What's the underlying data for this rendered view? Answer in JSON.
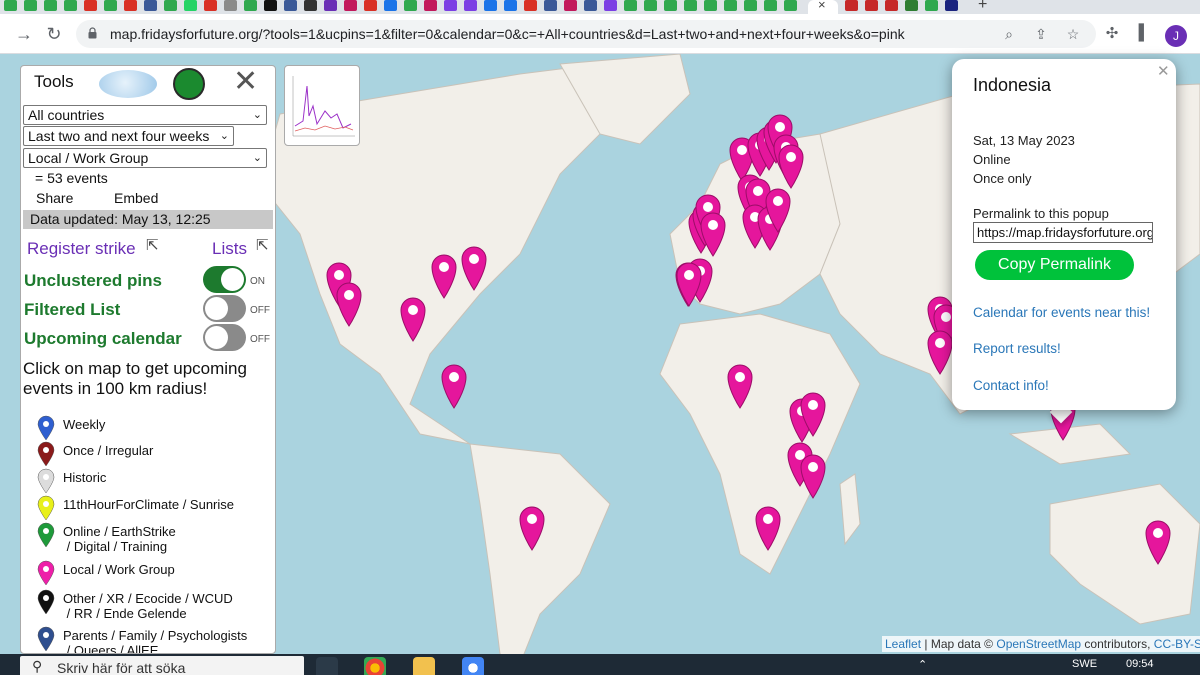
{
  "browser": {
    "url": "map.fridaysforfuture.org/?tools=1&ucpins=1&filter=0&calendar=0&c=+All+countries&d=Last+two+and+next+four+weeks&o=pink",
    "profile_initial": "J",
    "tab_favicon_colors": [
      "#2fa84f",
      "#2fa84f",
      "#2fa84f",
      "#2fa84f",
      "#d93025",
      "#2fa84f",
      "#d93025",
      "#3b5998",
      "#2fa84f",
      "#25d366",
      "#d93025",
      "#8a8a8a",
      "#2fa84f",
      "#111111",
      "#3b5998",
      "#333333",
      "#6a2fb5",
      "#c2185b",
      "#d93025",
      "#1a73e8",
      "#2fa84f",
      "#c2185b",
      "#7b3fe4",
      "#7b3fe4",
      "#1a73e8",
      "#1a73e8",
      "#d93025",
      "#3b5998",
      "#c2185b",
      "#3b5998",
      "#7b3fe4",
      "#2fa84f",
      "#2fa84f",
      "#2fa84f",
      "#2fa84f",
      "#2fa84f",
      "#2fa84f",
      "#2fa84f",
      "#2fa84f",
      "#2fa84f"
    ],
    "right_tab_favicon_colors": [
      "#c62828",
      "#c62828",
      "#c62828",
      "#2e7d32",
      "#2fa84f",
      "#1a237e"
    ]
  },
  "tools": {
    "title": "Tools",
    "country_select": "All countries",
    "period_select": "Last two and next four weeks",
    "type_select": "Local / Work Group",
    "event_count": "= 53 events",
    "share": "Share",
    "embed": "Embed",
    "data_updated": "Data updated: May 13, 12:25",
    "register_strike": "Register strike",
    "lists": "Lists",
    "toggles": [
      {
        "label": "Unclustered pins",
        "state": "ON",
        "on": true
      },
      {
        "label": "Filtered List",
        "state": "OFF",
        "on": false
      },
      {
        "label": "Upcoming calendar",
        "state": "OFF",
        "on": false
      }
    ],
    "hint": "Click on map to get upcoming events in 100 km radius!",
    "legend": [
      {
        "label": "Weekly",
        "color": "#2f5fd0"
      },
      {
        "label": "Once / Irregular",
        "color": "#8b1a1a"
      },
      {
        "label": "Historic",
        "color": "#dcdcdc"
      },
      {
        "label": "11thHourForClimate / Sunrise",
        "color": "#e8f01a"
      },
      {
        "label": "Online / EarthStrike\n / Digital / Training",
        "color": "#1e9a3a"
      },
      {
        "label": "Local / Work Group",
        "color": "#ee1fa9"
      },
      {
        "label": "Other / XR / Ecocide / WCUD\n / RR / Ende Gelende",
        "color": "#111111"
      },
      {
        "label": "Parents / Family / Psychologists\n / Queers / AllEE",
        "color": "#2f4f8f"
      }
    ]
  },
  "popup": {
    "title": "Indonesia",
    "date": "Sat, 13 May 2023",
    "mode": "Online",
    "frequency": "Once only",
    "permalink_label": "Permalink to this popup",
    "permalink_value": "https://map.fridaysforfuture.org",
    "copy_button": "Copy Permalink",
    "calendar_link": "Calendar for events near this!",
    "report_link": "Report results!",
    "contact_link": "Contact info!"
  },
  "attribution": {
    "leaflet": "Leaflet",
    "mapdata": " | Map data © ",
    "osm": "OpenStreetMap",
    "contributors": " contributors, ",
    "license": "CC-BY-S"
  },
  "taskbar": {
    "search_placeholder": "Skriv här för att söka",
    "time": "09:54",
    "lang": "SWE"
  },
  "colors": {
    "pin_pink": "#e5169c",
    "toggle_on": "#1d7a2e",
    "toggle_off": "#8a8a8a",
    "panel_green": "#1d7a2e",
    "link_purple": "#6a2fb5",
    "popup_link": "#2a77b8",
    "copy_green": "#00c23b"
  }
}
